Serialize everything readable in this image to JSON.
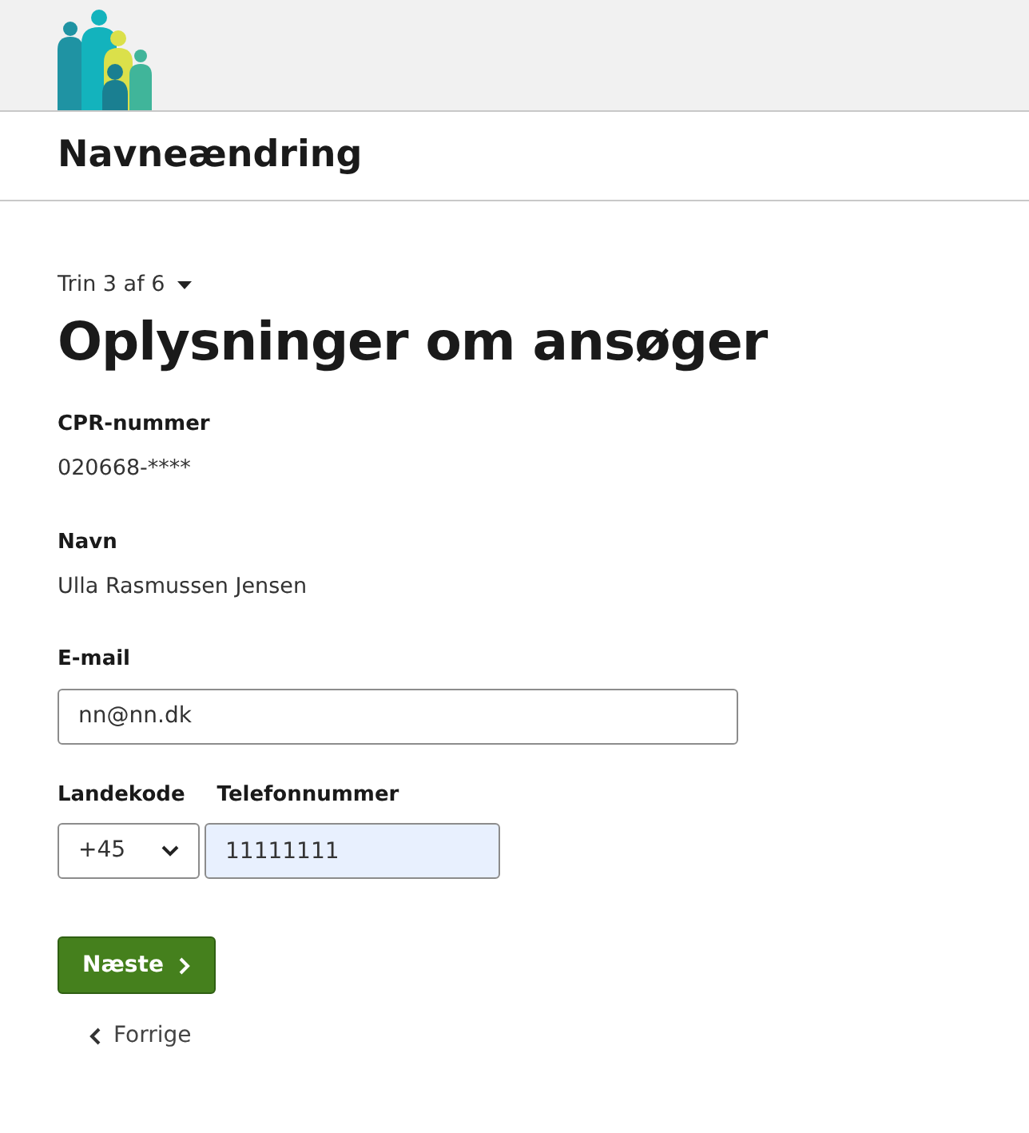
{
  "header": {
    "title": "Navneændring"
  },
  "step": {
    "label": "Trin 3 af 6"
  },
  "heading": "Oplysninger om ansøger",
  "info": [
    {
      "label": "CPR-nummer",
      "value": "020668-****"
    },
    {
      "label": "Navn",
      "value": "Ulla Rasmussen Jensen"
    }
  ],
  "email": {
    "label": "E-mail",
    "value": "nn@nn.dk"
  },
  "phone": {
    "country_label": "Landekode",
    "country_value": "+45",
    "number_label": "Telefonnummer",
    "number_value": "11111111",
    "autofilled": true
  },
  "next_button": {
    "label": "Næste"
  },
  "back_link": {
    "label": "Forrige"
  }
}
